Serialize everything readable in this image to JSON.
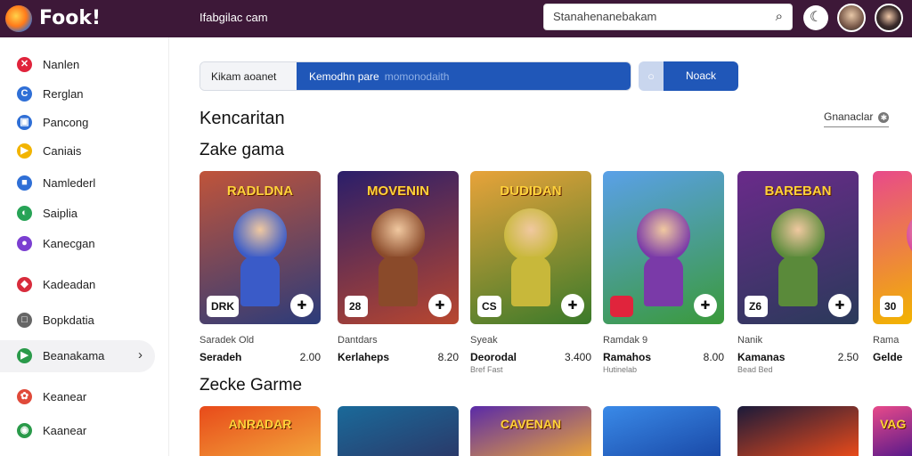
{
  "header": {
    "brand": "Fook!",
    "breadcrumb": "Ifabgilac cam",
    "search_placeholder": "Stanahenanebakam",
    "search_icon": "search-icon",
    "theme_icon": "moon-icon"
  },
  "sidebar": {
    "items": [
      {
        "label": "Nanlen",
        "icon": "x-icon",
        "color": "#e0243c",
        "glyph": "✕"
      },
      {
        "label": "Rerglan",
        "icon": "c-icon",
        "color": "#2f6fd6",
        "glyph": "C"
      },
      {
        "label": "Pancong",
        "icon": "grid-icon",
        "color": "#2f6fd6",
        "glyph": "▣"
      },
      {
        "label": "Caniais",
        "icon": "play-icon",
        "color": "#f2b400",
        "glyph": "▶"
      },
      {
        "label": "Namlederl",
        "icon": "box-icon",
        "color": "#2f6fd6",
        "glyph": "■"
      },
      {
        "label": "Saiplia",
        "icon": "swirl-icon",
        "color": "#27a356",
        "glyph": "◐"
      },
      {
        "label": "Kanecgan",
        "icon": "chat-icon",
        "color": "#7b3fd1",
        "glyph": "●"
      },
      {
        "label": "Kadeadan",
        "icon": "shield-icon",
        "color": "#d82c3c",
        "glyph": "◆"
      },
      {
        "label": "Bopkdatia",
        "icon": "square-icon",
        "color": "#666666",
        "glyph": "□"
      },
      {
        "label": "Beanakama",
        "icon": "store-icon",
        "color": "#2a9a4a",
        "glyph": "▶",
        "active": true
      },
      {
        "label": "Keanear",
        "icon": "puzzle-icon",
        "color": "#e04a3a",
        "glyph": "✿"
      },
      {
        "label": "Kaanear",
        "icon": "leaf-icon",
        "color": "#2a9a4a",
        "glyph": "◉"
      }
    ]
  },
  "tabs": {
    "left": "Kikam aoanet",
    "right": "Kemodhn pare",
    "placeholder": "momonodaith",
    "button": "Noack"
  },
  "section": {
    "title": "Kencaritan",
    "filter": "Gnanaclar"
  },
  "row1_title": "Zake gama",
  "row2_title": "Zecke Garme",
  "cards": [
    {
      "title": "RADLDNA",
      "badge": "DRK",
      "sub": "Saradek Old",
      "name": "Seradeh",
      "price": "2.00",
      "mini": "",
      "c1": "#c0543a",
      "c2": "#2b3b7a",
      "hero": "#3a5bc8"
    },
    {
      "title": "MOVENIN",
      "badge": "28",
      "sub": "Dantdars",
      "name": "Kerlaheps",
      "price": "8.20",
      "mini": "",
      "c1": "#2a1e6a",
      "c2": "#b9472f",
      "hero": "#8a4a2a"
    },
    {
      "title": "DUDIDAN",
      "badge": "CS",
      "sub": "Syeak",
      "name": "Deorodal",
      "price": "3.400",
      "mini": "Bref Fast",
      "c1": "#e8a33a",
      "c2": "#3a7a2a",
      "hero": "#c8b83a"
    },
    {
      "title": "",
      "badge": "",
      "sub": "Ramdak 9",
      "name": "Ramahos",
      "price": "8.00",
      "mini": "Hutinelab",
      "c1": "#5aa0e8",
      "c2": "#3a9a3a",
      "hero": "#7a3aa8"
    },
    {
      "title": "BAREBAN",
      "badge": "Z6",
      "sub": "Nanik",
      "name": "Kamanas",
      "price": "2.50",
      "mini": "Bead Bed",
      "c1": "#6a2a8a",
      "c2": "#2a3a5a",
      "hero": "#5a8a3a"
    },
    {
      "title": "",
      "badge": "30",
      "sub": "Rama",
      "name": "Gelde",
      "price": "",
      "mini": "",
      "c1": "#e84a8a",
      "c2": "#f2b400",
      "hero": "#d84aa0"
    }
  ],
  "cards2": [
    {
      "title": "ANRADAR",
      "c1": "#e84a1a",
      "c2": "#f2a43a"
    },
    {
      "title": "",
      "c1": "#1a6a9a",
      "c2": "#2a3a6a"
    },
    {
      "title": "CAVENAN",
      "c1": "#5a2aa8",
      "c2": "#e8a33a"
    },
    {
      "title": "",
      "c1": "#3a8ae8",
      "c2": "#1a4aa8"
    },
    {
      "title": "",
      "c1": "#1a1a3a",
      "c2": "#e84a1a"
    },
    {
      "title": "VAG",
      "c1": "#e84a8a",
      "c2": "#5a1a8a"
    }
  ]
}
